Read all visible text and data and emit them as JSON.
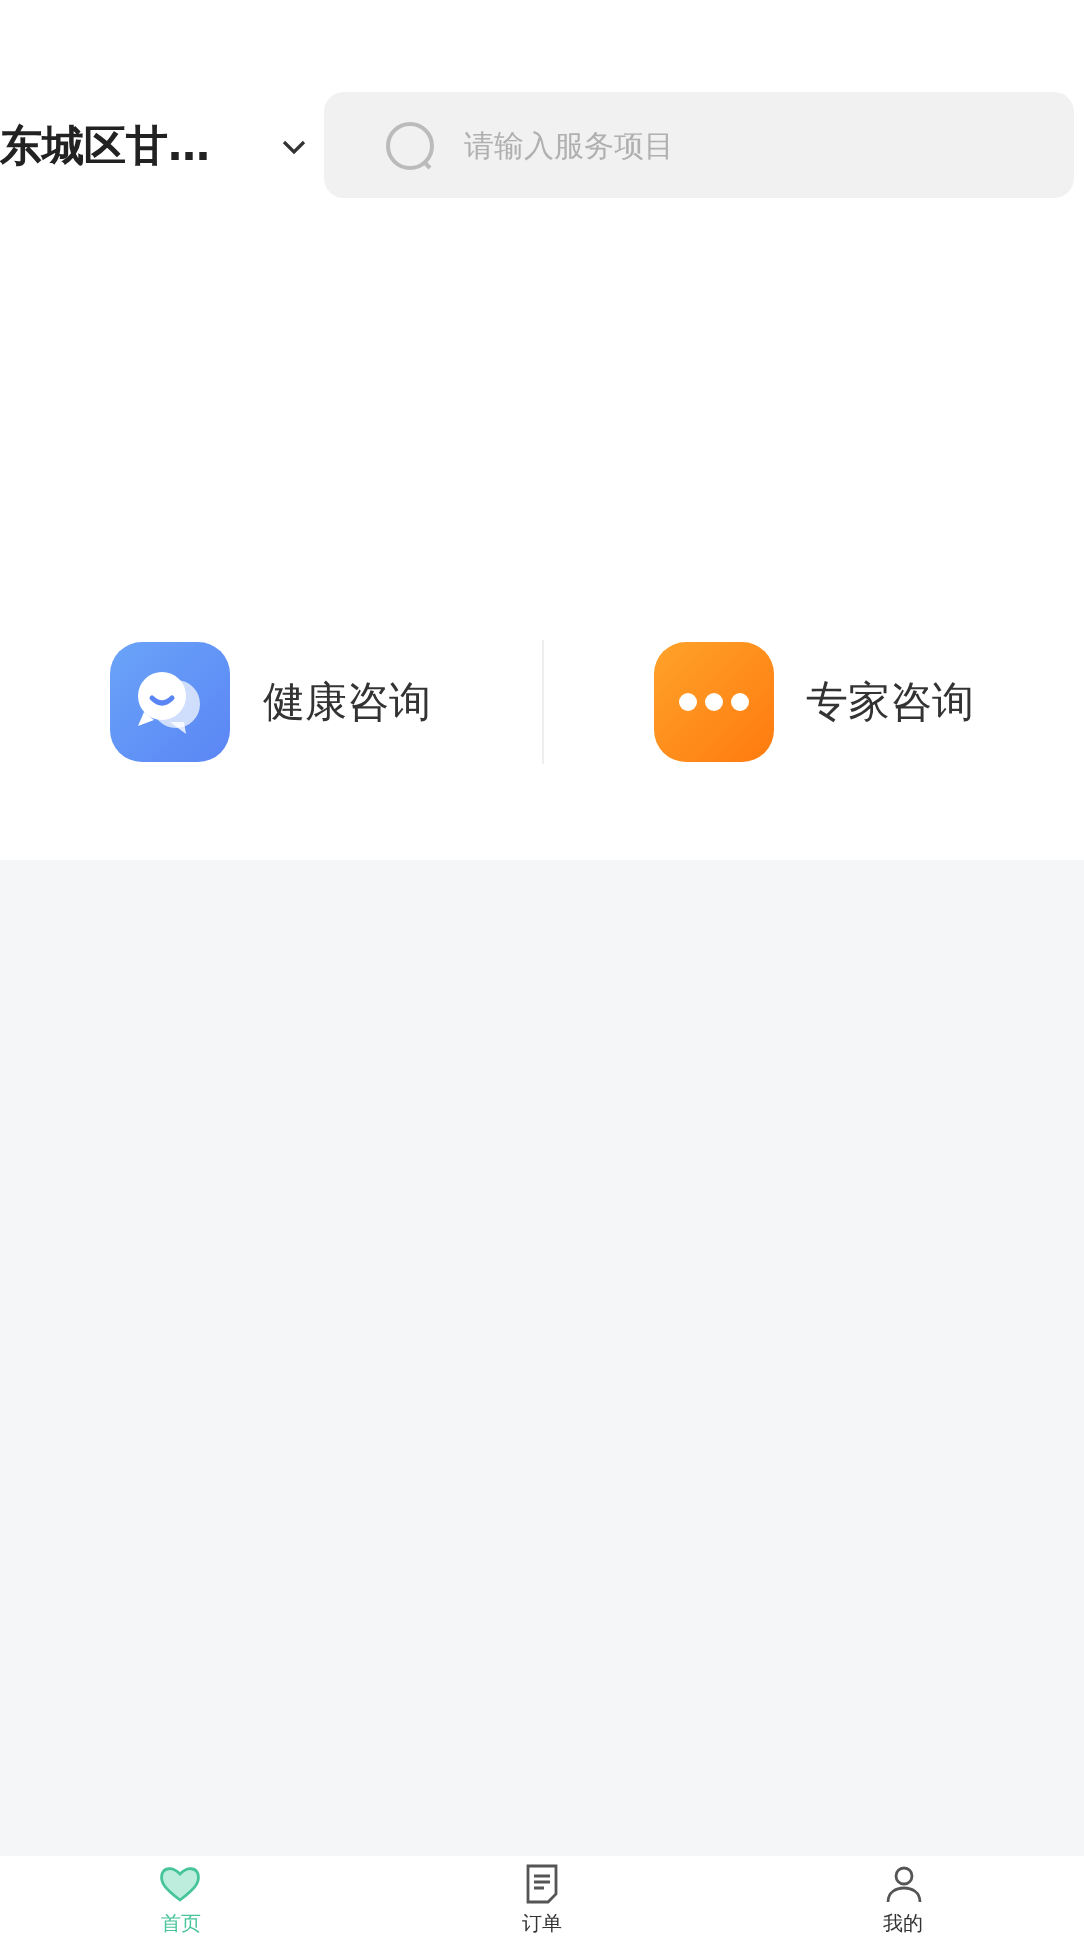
{
  "header": {
    "location": "东城区甘…",
    "search": {
      "placeholder": "请输入服务项目"
    }
  },
  "services": [
    {
      "kind": "chat",
      "label": "健康咨询"
    },
    {
      "kind": "more",
      "label": "专家咨询"
    }
  ],
  "tabs": [
    {
      "kind": "home",
      "label": "首页",
      "selected": true
    },
    {
      "kind": "orders",
      "label": "订单",
      "selected": false
    },
    {
      "kind": "profile",
      "label": "我的",
      "selected": false
    }
  ]
}
